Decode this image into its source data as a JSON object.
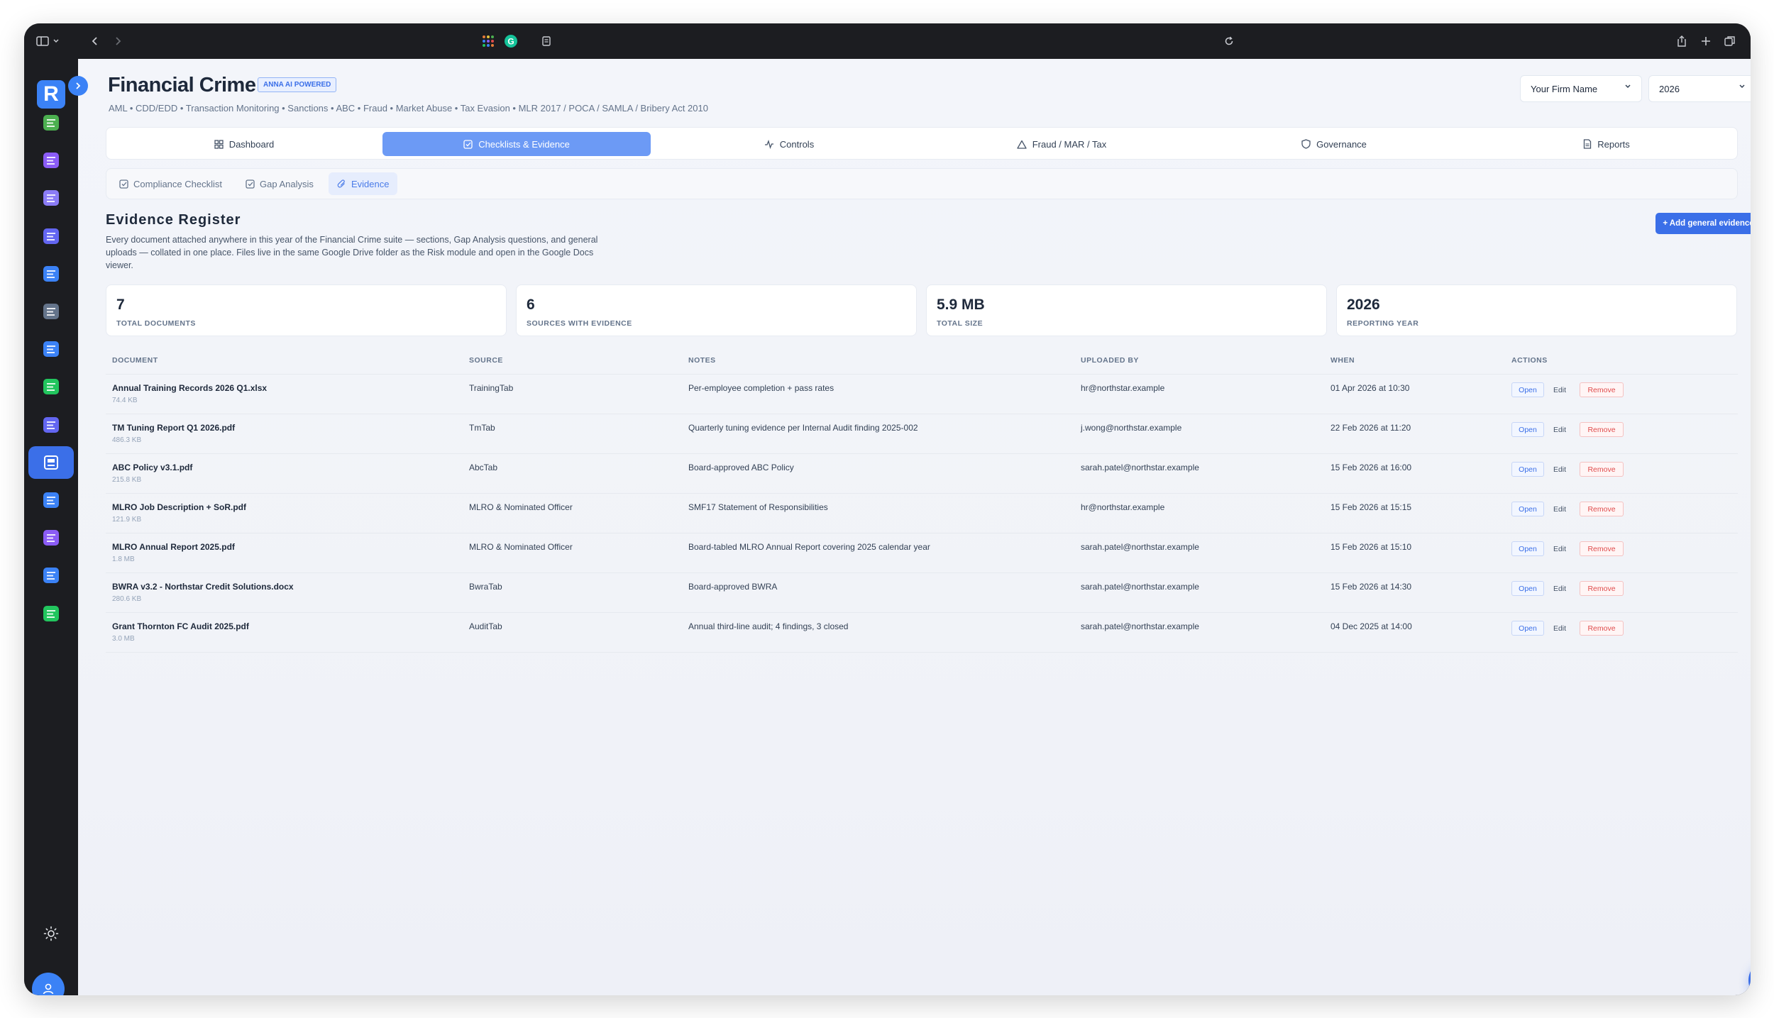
{
  "app": {
    "logo_letter": "R",
    "title": "Financial Crime",
    "badge": "ANNA AI POWERED",
    "subtitle": "AML • CDD/EDD • Transaction Monitoring • Sanctions • ABC • Fraud • Market Abuse • Tax Evasion • MLR 2017 / POCA / SAMLA / Bribery Act 2010"
  },
  "header": {
    "firm_select": "Your Firm Name",
    "year_select": "2026"
  },
  "sidebar": {
    "items": [
      {
        "icon": "checklist-icon",
        "color": "#4caf50"
      },
      {
        "icon": "building-icon",
        "color": "#8b5cf6"
      },
      {
        "icon": "people-icon",
        "color": "#8b7cf6"
      },
      {
        "icon": "shield-icon",
        "color": "#6366f1"
      },
      {
        "icon": "chart-icon",
        "color": "#3b82f6"
      },
      {
        "icon": "news-icon",
        "color": "#64748b"
      },
      {
        "icon": "monitor-icon",
        "color": "#3b82f6"
      },
      {
        "icon": "shield-check-icon",
        "color": "#22c55e"
      },
      {
        "icon": "target-icon",
        "color": "#6366f1"
      },
      {
        "icon": "register-icon",
        "color": "#ffffff",
        "active": true
      },
      {
        "icon": "lock-shield-icon",
        "color": "#3b82f6"
      },
      {
        "icon": "list-icon",
        "color": "#8b5cf6"
      },
      {
        "icon": "report-icon",
        "color": "#3b82f6"
      },
      {
        "icon": "note-icon",
        "color": "#22c55e"
      }
    ]
  },
  "tabs": [
    {
      "label": "Dashboard",
      "icon": "grid-icon"
    },
    {
      "label": "Checklists & Evidence",
      "icon": "checkbox-icon",
      "active": true
    },
    {
      "label": "Controls",
      "icon": "activity-icon"
    },
    {
      "label": "Fraud / MAR / Tax",
      "icon": "warning-icon"
    },
    {
      "label": "Governance",
      "icon": "shield-outline-icon"
    },
    {
      "label": "Reports",
      "icon": "document-icon"
    }
  ],
  "subtabs": [
    {
      "label": "Compliance Checklist",
      "icon": "checkbox-icon"
    },
    {
      "label": "Gap Analysis",
      "icon": "checkbox-icon"
    },
    {
      "label": "Evidence",
      "icon": "paperclip-icon",
      "active": true
    }
  ],
  "register": {
    "title": "Evidence Register",
    "description": "Every document attached anywhere in this year of the Financial Crime suite — sections, Gap Analysis questions, and general uploads — collated in one place. Files live in the same Google Drive folder as the Risk module and open in the Google Docs viewer.",
    "add_button": "+ Add general evidence"
  },
  "stats": [
    {
      "value": "7",
      "label": "TOTAL DOCUMENTS"
    },
    {
      "value": "6",
      "label": "SOURCES WITH EVIDENCE"
    },
    {
      "value": "5.9 MB",
      "label": "TOTAL SIZE"
    },
    {
      "value": "2026",
      "label": "REPORTING YEAR"
    }
  ],
  "table": {
    "columns": [
      "DOCUMENT",
      "SOURCE",
      "NOTES",
      "UPLOADED BY",
      "WHEN",
      "ACTIONS"
    ],
    "actions": {
      "open": "Open",
      "edit": "Edit",
      "remove": "Remove"
    },
    "rows": [
      {
        "document": "Annual Training Records 2026 Q1.xlsx",
        "size": "74.4 KB",
        "source": "TrainingTab",
        "notes": "Per-employee completion + pass rates",
        "uploaded_by": "hr@northstar.example",
        "when": "01 Apr 2026 at 10:30"
      },
      {
        "document": "TM Tuning Report Q1 2026.pdf",
        "size": "486.3 KB",
        "source": "TmTab",
        "notes": "Quarterly tuning evidence per Internal Audit finding 2025-002",
        "uploaded_by": "j.wong@northstar.example",
        "when": "22 Feb 2026 at 11:20"
      },
      {
        "document": "ABC Policy v3.1.pdf",
        "size": "215.8 KB",
        "source": "AbcTab",
        "notes": "Board-approved ABC Policy",
        "uploaded_by": "sarah.patel@northstar.example",
        "when": "15 Feb 2026 at 16:00"
      },
      {
        "document": "MLRO Job Description + SoR.pdf",
        "size": "121.9 KB",
        "source": "MLRO & Nominated Officer",
        "notes": "SMF17 Statement of Responsibilities",
        "uploaded_by": "hr@northstar.example",
        "when": "15 Feb 2026 at 15:15"
      },
      {
        "document": "MLRO Annual Report 2025.pdf",
        "size": "1.8 MB",
        "source": "MLRO & Nominated Officer",
        "notes": "Board-tabled MLRO Annual Report covering 2025 calendar year",
        "uploaded_by": "sarah.patel@northstar.example",
        "when": "15 Feb 2026 at 15:10"
      },
      {
        "document": "BWRA v3.2 - Northstar Credit Solutions.docx",
        "size": "280.6 KB",
        "source": "BwraTab",
        "notes": "Board-approved BWRA",
        "uploaded_by": "sarah.patel@northstar.example",
        "when": "15 Feb 2026 at 14:30"
      },
      {
        "document": "Grant Thornton FC Audit 2025.pdf",
        "size": "3.0 MB",
        "source": "AuditTab",
        "notes": "Annual third-line audit; 4 findings, 3 closed",
        "uploaded_by": "sarah.patel@northstar.example",
        "when": "04 Dec 2025 at 14:00"
      }
    ]
  }
}
